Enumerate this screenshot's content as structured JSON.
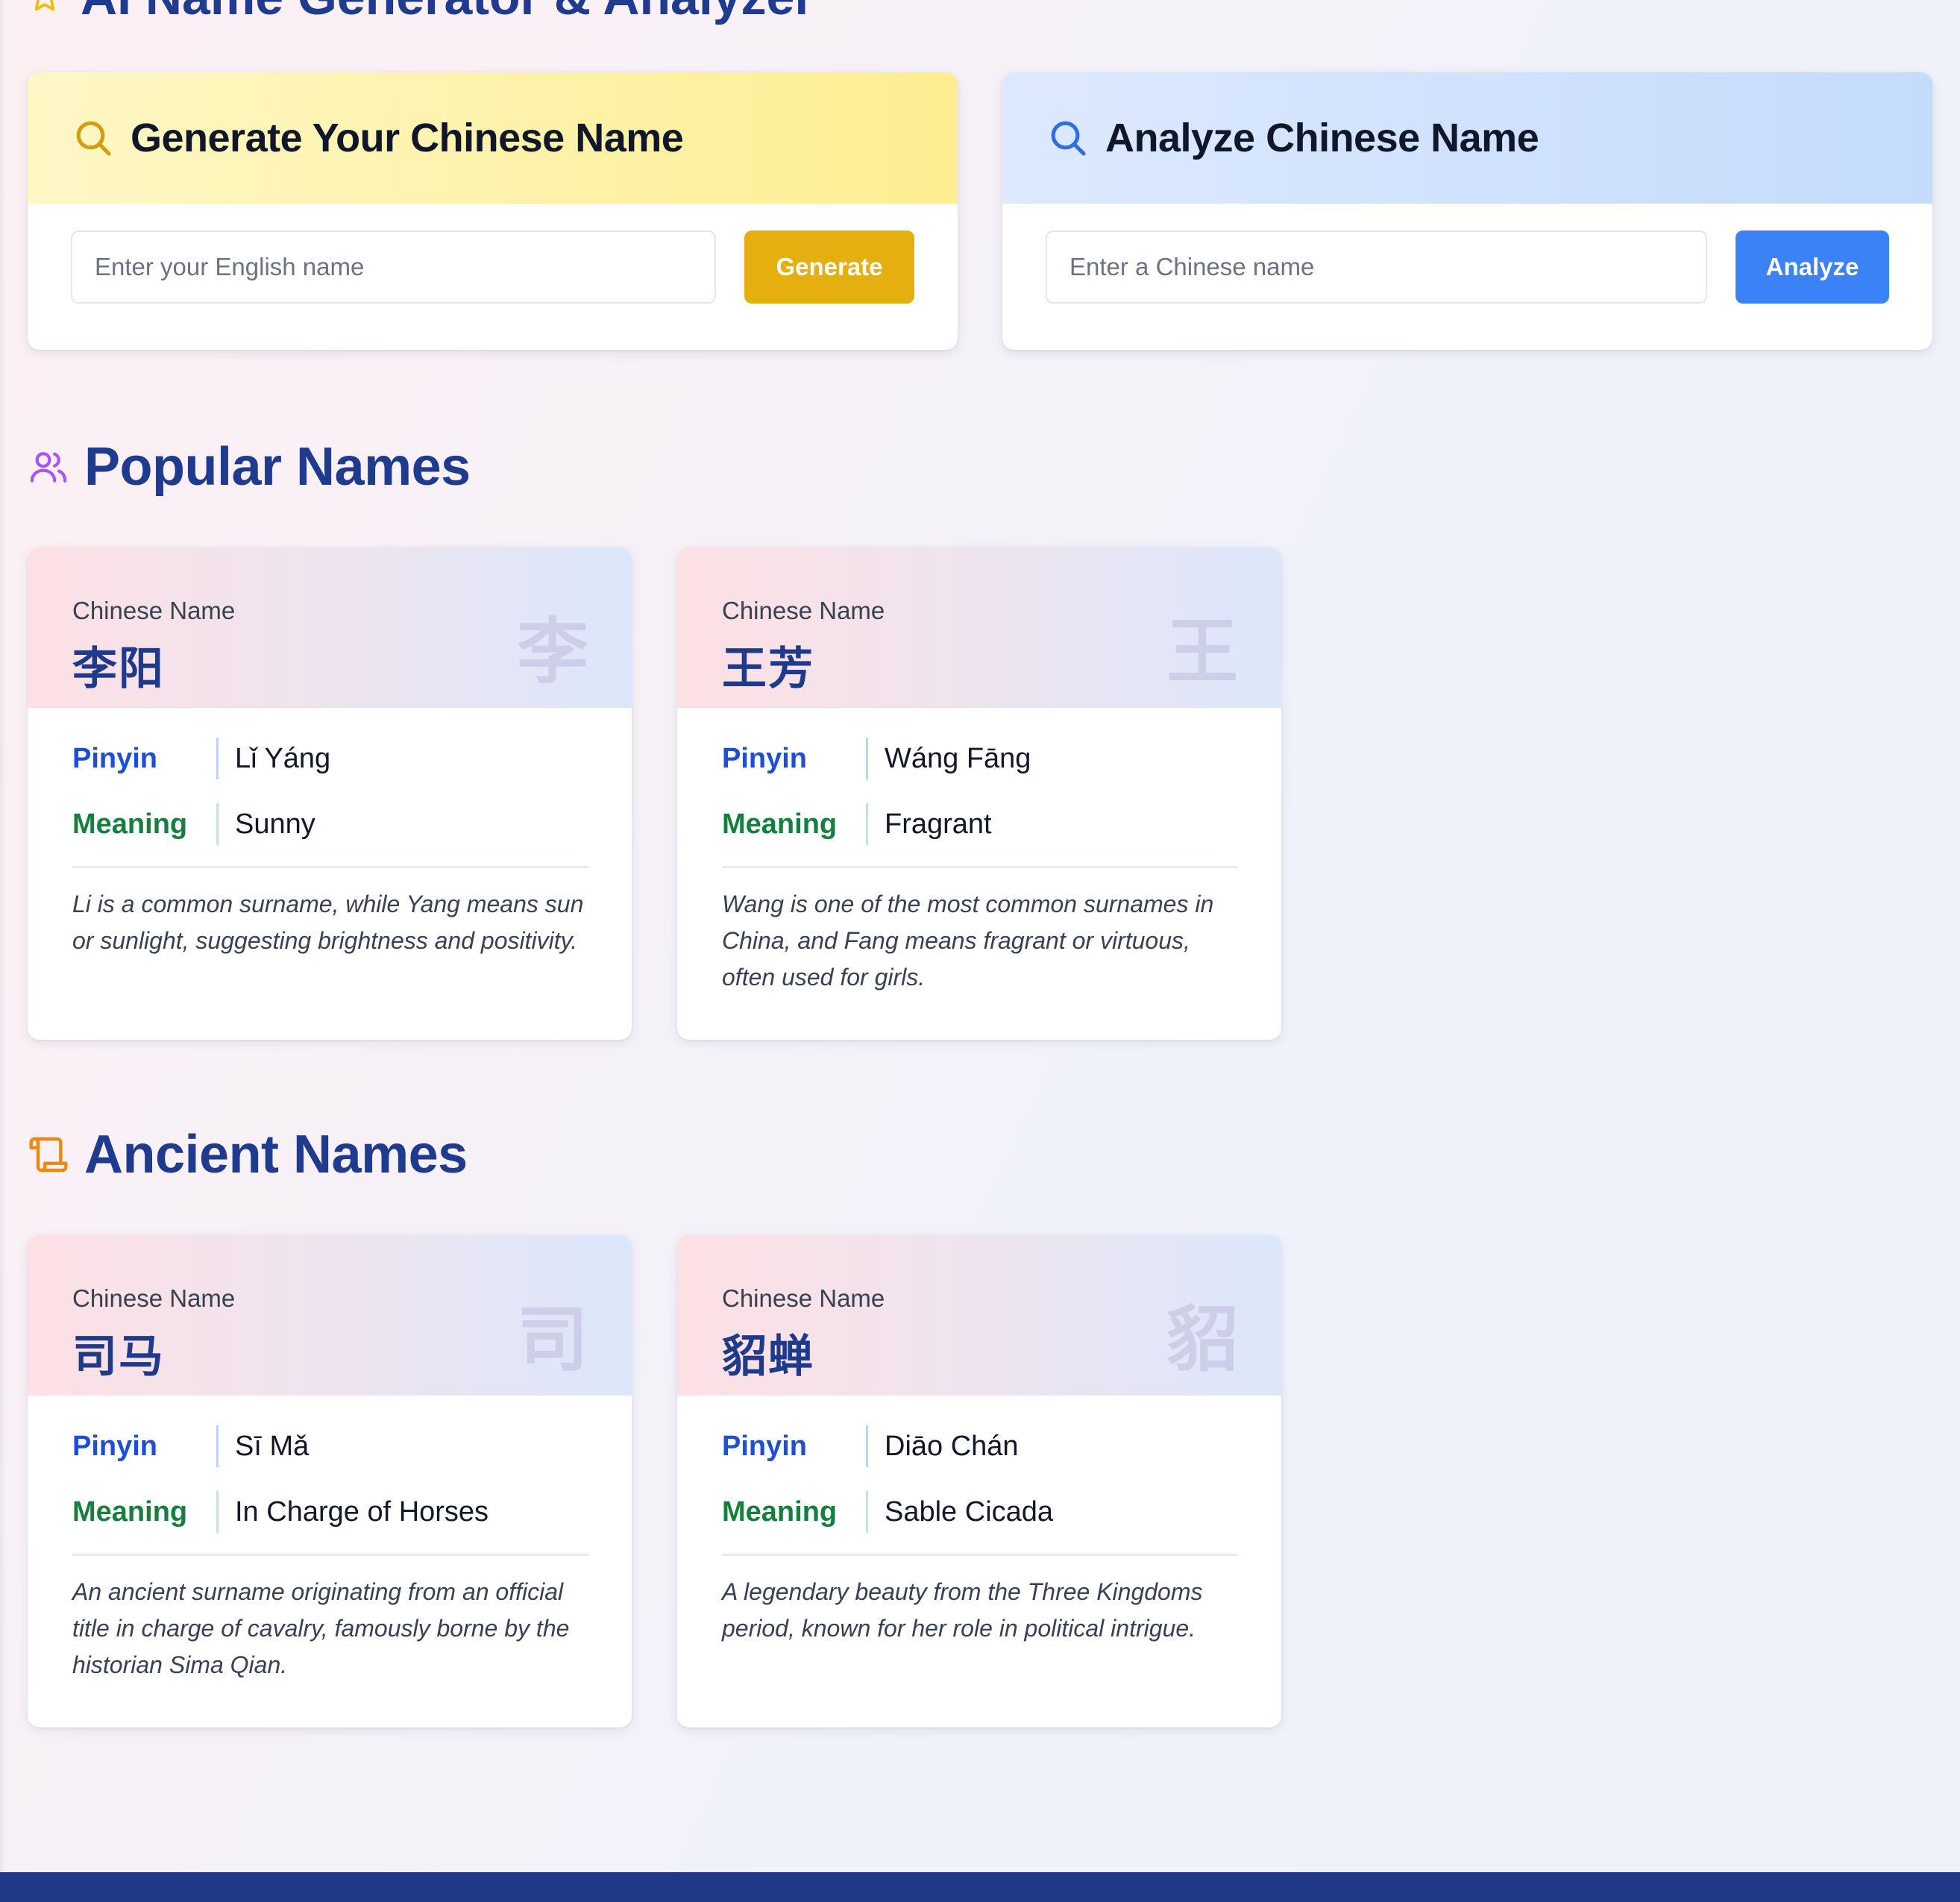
{
  "page": {
    "title": "AI Name Generator & Analyzer"
  },
  "generator": {
    "title": "Generate Your Chinese Name",
    "placeholder": "Enter your English name",
    "button": "Generate"
  },
  "analyzer": {
    "title": "Analyze Chinese Name",
    "placeholder": "Enter a Chinese name",
    "button": "Analyze"
  },
  "labels": {
    "chinese_name": "Chinese Name",
    "pinyin": "Pinyin",
    "meaning": "Meaning"
  },
  "popular": {
    "title": "Popular Names",
    "cards": [
      {
        "chinese": "李阳",
        "watermark": "李",
        "pinyin": "Lǐ Yáng",
        "meaning": "Sunny",
        "description": "Li is a common surname, while Yang means sun or sunlight, suggesting brightness and positivity."
      },
      {
        "chinese": "王芳",
        "watermark": "王",
        "pinyin": "Wáng Fāng",
        "meaning": "Fragrant",
        "description": "Wang is one of the most common surnames in China, and Fang means fragrant or virtuous, often used for girls."
      }
    ]
  },
  "ancient": {
    "title": "Ancient Names",
    "cards": [
      {
        "chinese": "司马",
        "watermark": "司",
        "pinyin": "Sī Mǎ",
        "meaning": "In Charge of Horses",
        "description": "An ancient surname originating from an official title in charge of cavalry, famously borne by the historian Sima Qian."
      },
      {
        "chinese": "貂蝉",
        "watermark": "貂",
        "pinyin": "Diāo Chán",
        "meaning": "Sable Cicada",
        "description": "A legendary beauty from the Three Kingdoms period, known for her role in political intrigue."
      }
    ]
  },
  "icons": {
    "header": "star-icon",
    "generator": "search-icon",
    "analyzer": "search-icon",
    "popular": "users-icon",
    "ancient": "scroll-icon"
  },
  "colors": {
    "heading": "#1f3b8f",
    "generate_button": "#e5b00f",
    "analyze_button": "#3b82f6",
    "pinyin_label": "#1d4ed8",
    "meaning_label": "#15803d",
    "footer": "#1f3986"
  }
}
